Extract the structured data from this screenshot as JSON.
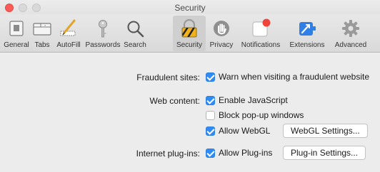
{
  "window": {
    "title": "Security"
  },
  "toolbar": {
    "items": [
      {
        "label": "General",
        "icon": "general-icon"
      },
      {
        "label": "Tabs",
        "icon": "tabs-icon"
      },
      {
        "label": "AutoFill",
        "icon": "autofill-icon"
      },
      {
        "label": "Passwords",
        "icon": "key-icon"
      },
      {
        "label": "Search",
        "icon": "search-icon"
      },
      {
        "label": "Security",
        "icon": "security-icon",
        "selected": true
      },
      {
        "label": "Privacy",
        "icon": "hand-icon"
      },
      {
        "label": "Notifications",
        "icon": "notifications-icon"
      },
      {
        "label": "Extensions",
        "icon": "extensions-icon"
      },
      {
        "label": "Advanced",
        "icon": "gear-icon"
      }
    ]
  },
  "security": {
    "fraudulent_label": "Fraudulent sites:",
    "fraudulent_option": "Warn when visiting a fraudulent website",
    "fraudulent_checked": true,
    "web_content_label": "Web content:",
    "javascript_option": "Enable JavaScript",
    "javascript_checked": true,
    "popup_option": "Block pop-up windows",
    "popup_checked": false,
    "webgl_option": "Allow WebGL",
    "webgl_checked": true,
    "webgl_button": "WebGL Settings...",
    "plugins_label": "Internet plug-ins:",
    "plugins_option": "Allow Plug-ins",
    "plugins_checked": true,
    "plugins_button": "Plug-in Settings..."
  },
  "colors": {
    "accent": "#2f8cf6",
    "close": "#fc5b57"
  }
}
